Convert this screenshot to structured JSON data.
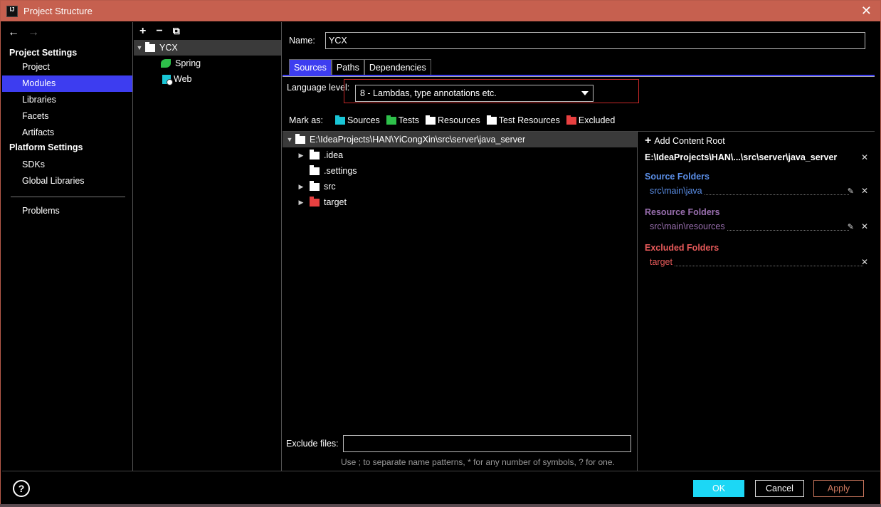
{
  "window": {
    "title": "Project Structure",
    "app_icon": "IJ"
  },
  "nav": {
    "back_glyph": "🡐",
    "forward_glyph": "🡒",
    "sections": [
      {
        "heading": "Project Settings",
        "items": [
          "Project",
          "Modules",
          "Libraries",
          "Facets",
          "Artifacts"
        ]
      },
      {
        "heading": "Platform Settings",
        "items": [
          "SDKs",
          "Global Libraries"
        ]
      }
    ],
    "problems": "Problems",
    "selected": "Modules"
  },
  "modules": {
    "toolbar": {
      "add": "+",
      "remove": "−",
      "copy": "⧉"
    },
    "root": "YCX",
    "children": [
      "Spring",
      "Web"
    ]
  },
  "content": {
    "name_label": "Name:",
    "name_value": "YCX",
    "tabs": [
      "Sources",
      "Paths",
      "Dependencies"
    ],
    "active_tab": "Sources",
    "language_level_label": "Language level:",
    "language_level_value": "8 - Lambdas, type annotations etc.",
    "mark_as_label": "Mark as:",
    "mark_as": [
      {
        "label": "Sources",
        "color": "#19c6d6"
      },
      {
        "label": "Tests",
        "color": "#2ec04a"
      },
      {
        "label": "Resources",
        "color": "#ffffff"
      },
      {
        "label": "Test Resources",
        "color": "#ffffff"
      },
      {
        "label": "Excluded",
        "color": "#e84040"
      }
    ],
    "tree": {
      "root": "E:\\IdeaProjects\\HAN\\YiCongXin\\src\\server\\java_server",
      "children": [
        {
          "name": ".idea",
          "expandable": true,
          "color": "#ffffff"
        },
        {
          "name": ".settings",
          "expandable": false,
          "color": "#ffffff"
        },
        {
          "name": "src",
          "expandable": true,
          "color": "#ffffff"
        },
        {
          "name": "target",
          "expandable": true,
          "color": "#e84040"
        }
      ]
    },
    "exclude_label": "Exclude files:",
    "exclude_value": "",
    "exclude_hint": "Use ; to separate name patterns, * for any number of symbols, ? for one."
  },
  "roots_panel": {
    "add_label": "Add Content Root",
    "root_path": "E:\\IdeaProjects\\HAN\\...\\src\\server\\java_server",
    "source_heading": "Source Folders",
    "source_color": "#5b8fe8",
    "source_entries": [
      "src\\main\\java"
    ],
    "resource_heading": "Resource Folders",
    "resource_color": "#9a6fb0",
    "resource_entries": [
      "src\\main\\resources"
    ],
    "excluded_heading": "Excluded Folders",
    "excluded_color": "#e85a5a",
    "excluded_entries": [
      "target"
    ]
  },
  "buttons": {
    "help": "?",
    "ok": "OK",
    "cancel": "Cancel",
    "apply": "Apply"
  }
}
